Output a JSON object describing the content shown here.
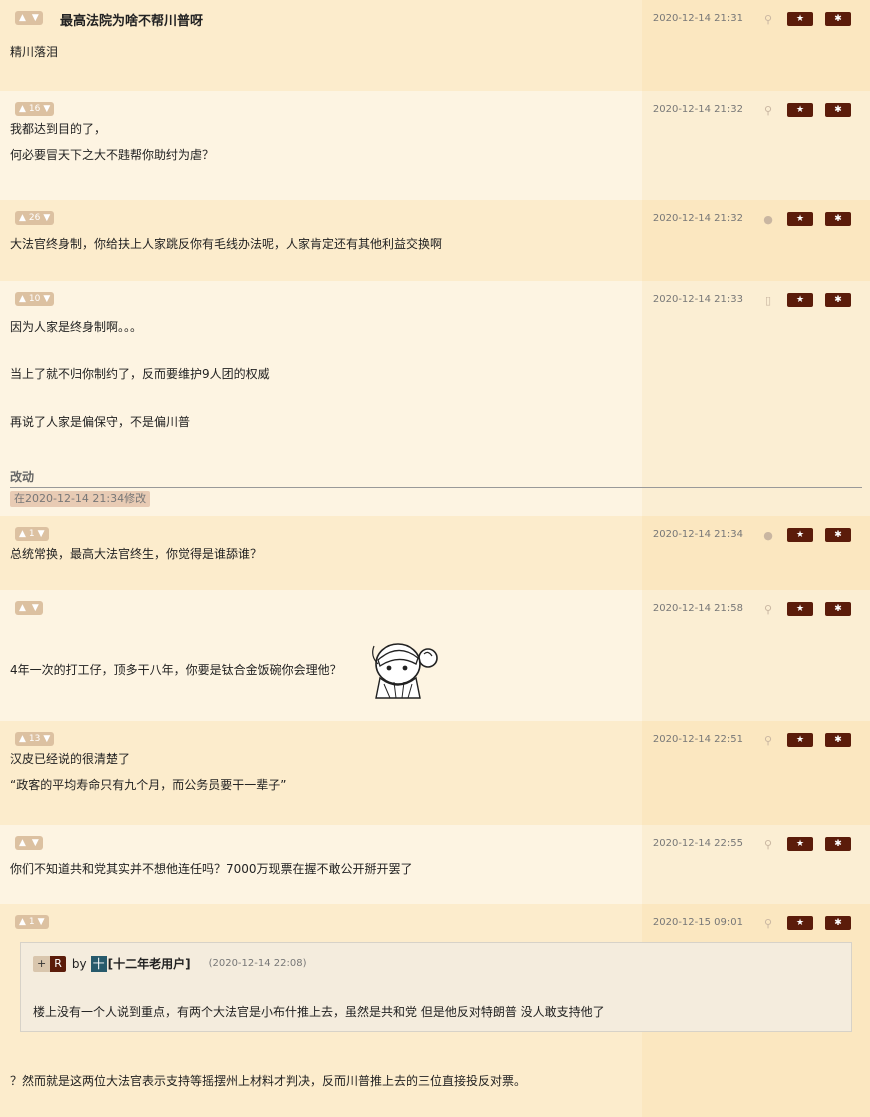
{
  "posts": [
    {
      "votes": "",
      "title": "最高法院为啥不帮川普呀",
      "time": "2020-12-14 21:31",
      "device": "android",
      "lines": [
        "精川落泪"
      ]
    },
    {
      "votes": "16",
      "time": "2020-12-14 21:32",
      "device": "android",
      "lines": [
        "我都达到目的了，",
        "何必要冒天下之大不韪帮你助纣为虐？"
      ]
    },
    {
      "votes": "26",
      "time": "2020-12-14 21:32",
      "device": "apple",
      "lines": [
        "大法官终身制，你给扶上人家跳反你有毛线办法呢，人家肯定还有其他利益交换啊"
      ]
    },
    {
      "votes": "10",
      "time": "2020-12-14 21:33",
      "device": "mobile",
      "lines": [
        "因为人家是终身制啊。。。",
        "当上了就不归你制约了，反而要维护9人团的权威",
        "再说了人家是偏保守，不是偏川普"
      ],
      "edit_label": "改动",
      "edit_note": "在2020-12-14 21:34修改"
    },
    {
      "votes": "1",
      "time": "2020-12-14 21:34",
      "device": "apple",
      "lines": [
        "总统常换，最高大法官终生，你觉得是谁舔谁？"
      ]
    },
    {
      "votes": "",
      "time": "2020-12-14 21:58",
      "device": "android",
      "lines": [
        "4年一次的打工仔，顶多干八年，你要是钛合金饭碗你会理他？"
      ]
    },
    {
      "votes": "13",
      "time": "2020-12-14 22:51",
      "device": "android",
      "lines": [
        "汉皮已经说的很清楚了",
        "“政客的平均寿命只有九个月，而公务员要干一辈子”"
      ]
    },
    {
      "votes": "",
      "time": "2020-12-14 22:55",
      "device": "android",
      "lines": [
        "你们不知道共和党其实并不想他连任吗？7000万现票在握不敢公开掰开罢了"
      ]
    },
    {
      "votes": "1",
      "time": "2020-12-15 09:01",
      "device": "android",
      "quote": {
        "plus": "+",
        "r": "R",
        "by": "by",
        "badge": "十",
        "user": "[十二年老用户]",
        "time": "(2020-12-14 22:08)",
        "text": "楼上没有一个人说到重点，有两个大法官是小布什推上去，虽然是共和党 但是他反对特朗普 没人敢支持他了"
      },
      "lines": [
        "？然而就是这两位大法官表示支持等摇摆州上材料才判决，反而川普推上去的三位直接投反对票。"
      ]
    }
  ],
  "icons": {
    "thumb_up": "thumb-up-icon",
    "thumb_down": "thumb-down-icon",
    "star": "star-icon",
    "gear": "gear-icon",
    "android": "android-icon",
    "apple": "apple-icon",
    "mobile": "mobile-icon"
  },
  "colors": {
    "bg_alt1": "#fceccc",
    "bg_alt2": "#fdf4e2",
    "action_button": "#5b1c0a",
    "vote_badge": "#dcc1a1",
    "user_badge": "#275a6b"
  }
}
